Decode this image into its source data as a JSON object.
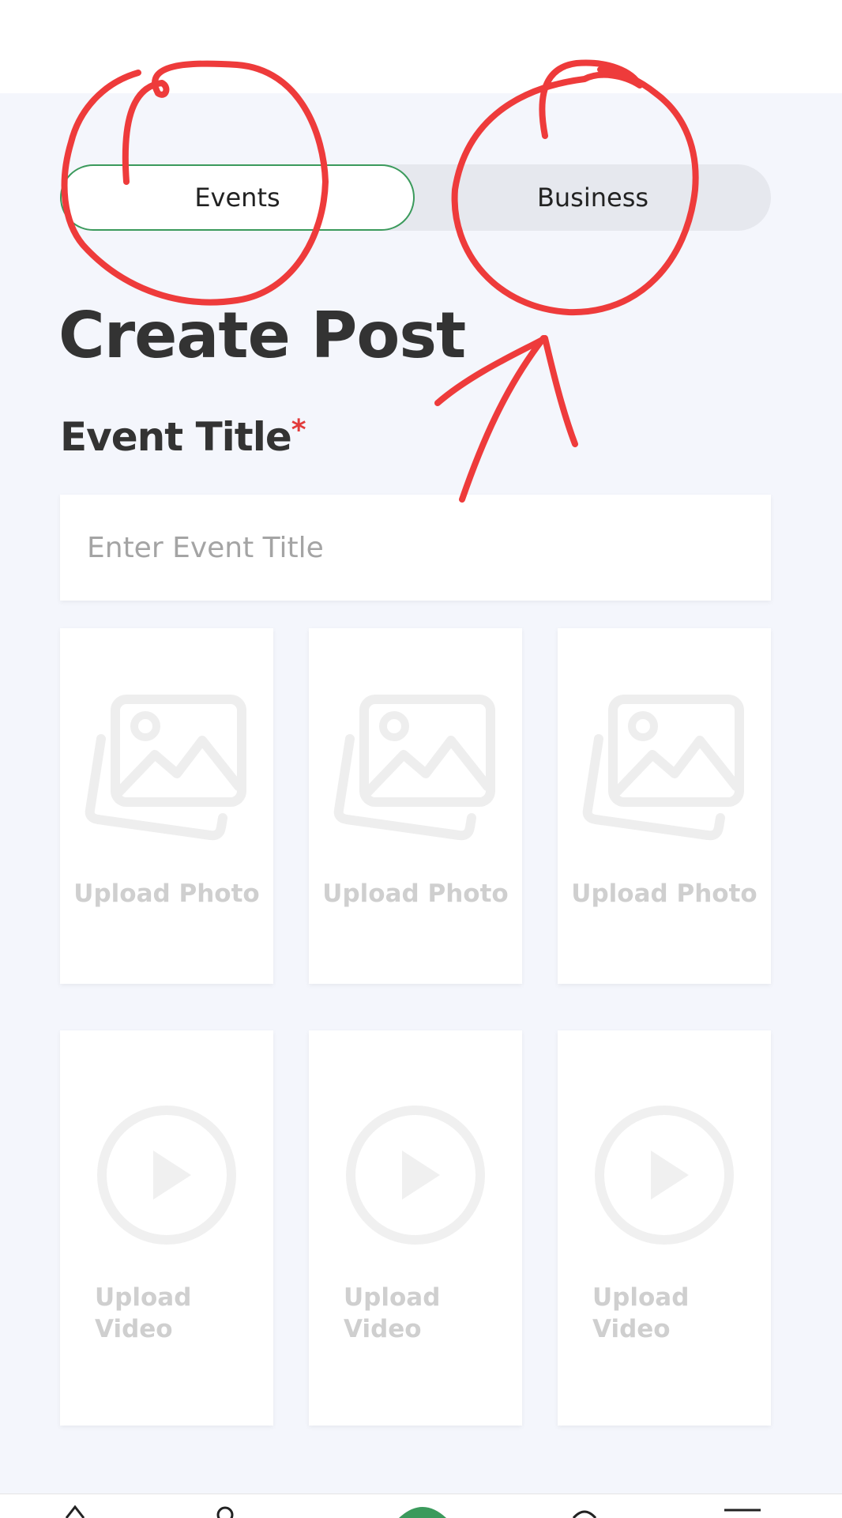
{
  "toggle": {
    "events_label": "Events",
    "business_label": "Business",
    "active": "Events"
  },
  "page_title": "Create Post",
  "event_title": {
    "label": "Event Title",
    "required_marker": "*",
    "placeholder": "Enter Event Title",
    "value": ""
  },
  "photo_uploads": [
    {
      "label": "Upload Photo",
      "icon": "image-icon"
    },
    {
      "label": "Upload Photo",
      "icon": "image-icon"
    },
    {
      "label": "Upload Photo",
      "icon": "image-icon"
    }
  ],
  "video_uploads": [
    {
      "label": "Upload Video",
      "icon": "play-circle-icon"
    },
    {
      "label": "Upload Video",
      "icon": "play-circle-icon"
    },
    {
      "label": "Upload Video",
      "icon": "play-circle-icon"
    }
  ],
  "colors": {
    "accent_green": "#3b9a5c",
    "required_red": "#e23b3b",
    "annotation_red": "#ee3b3b",
    "background": "#f4f6fc"
  }
}
